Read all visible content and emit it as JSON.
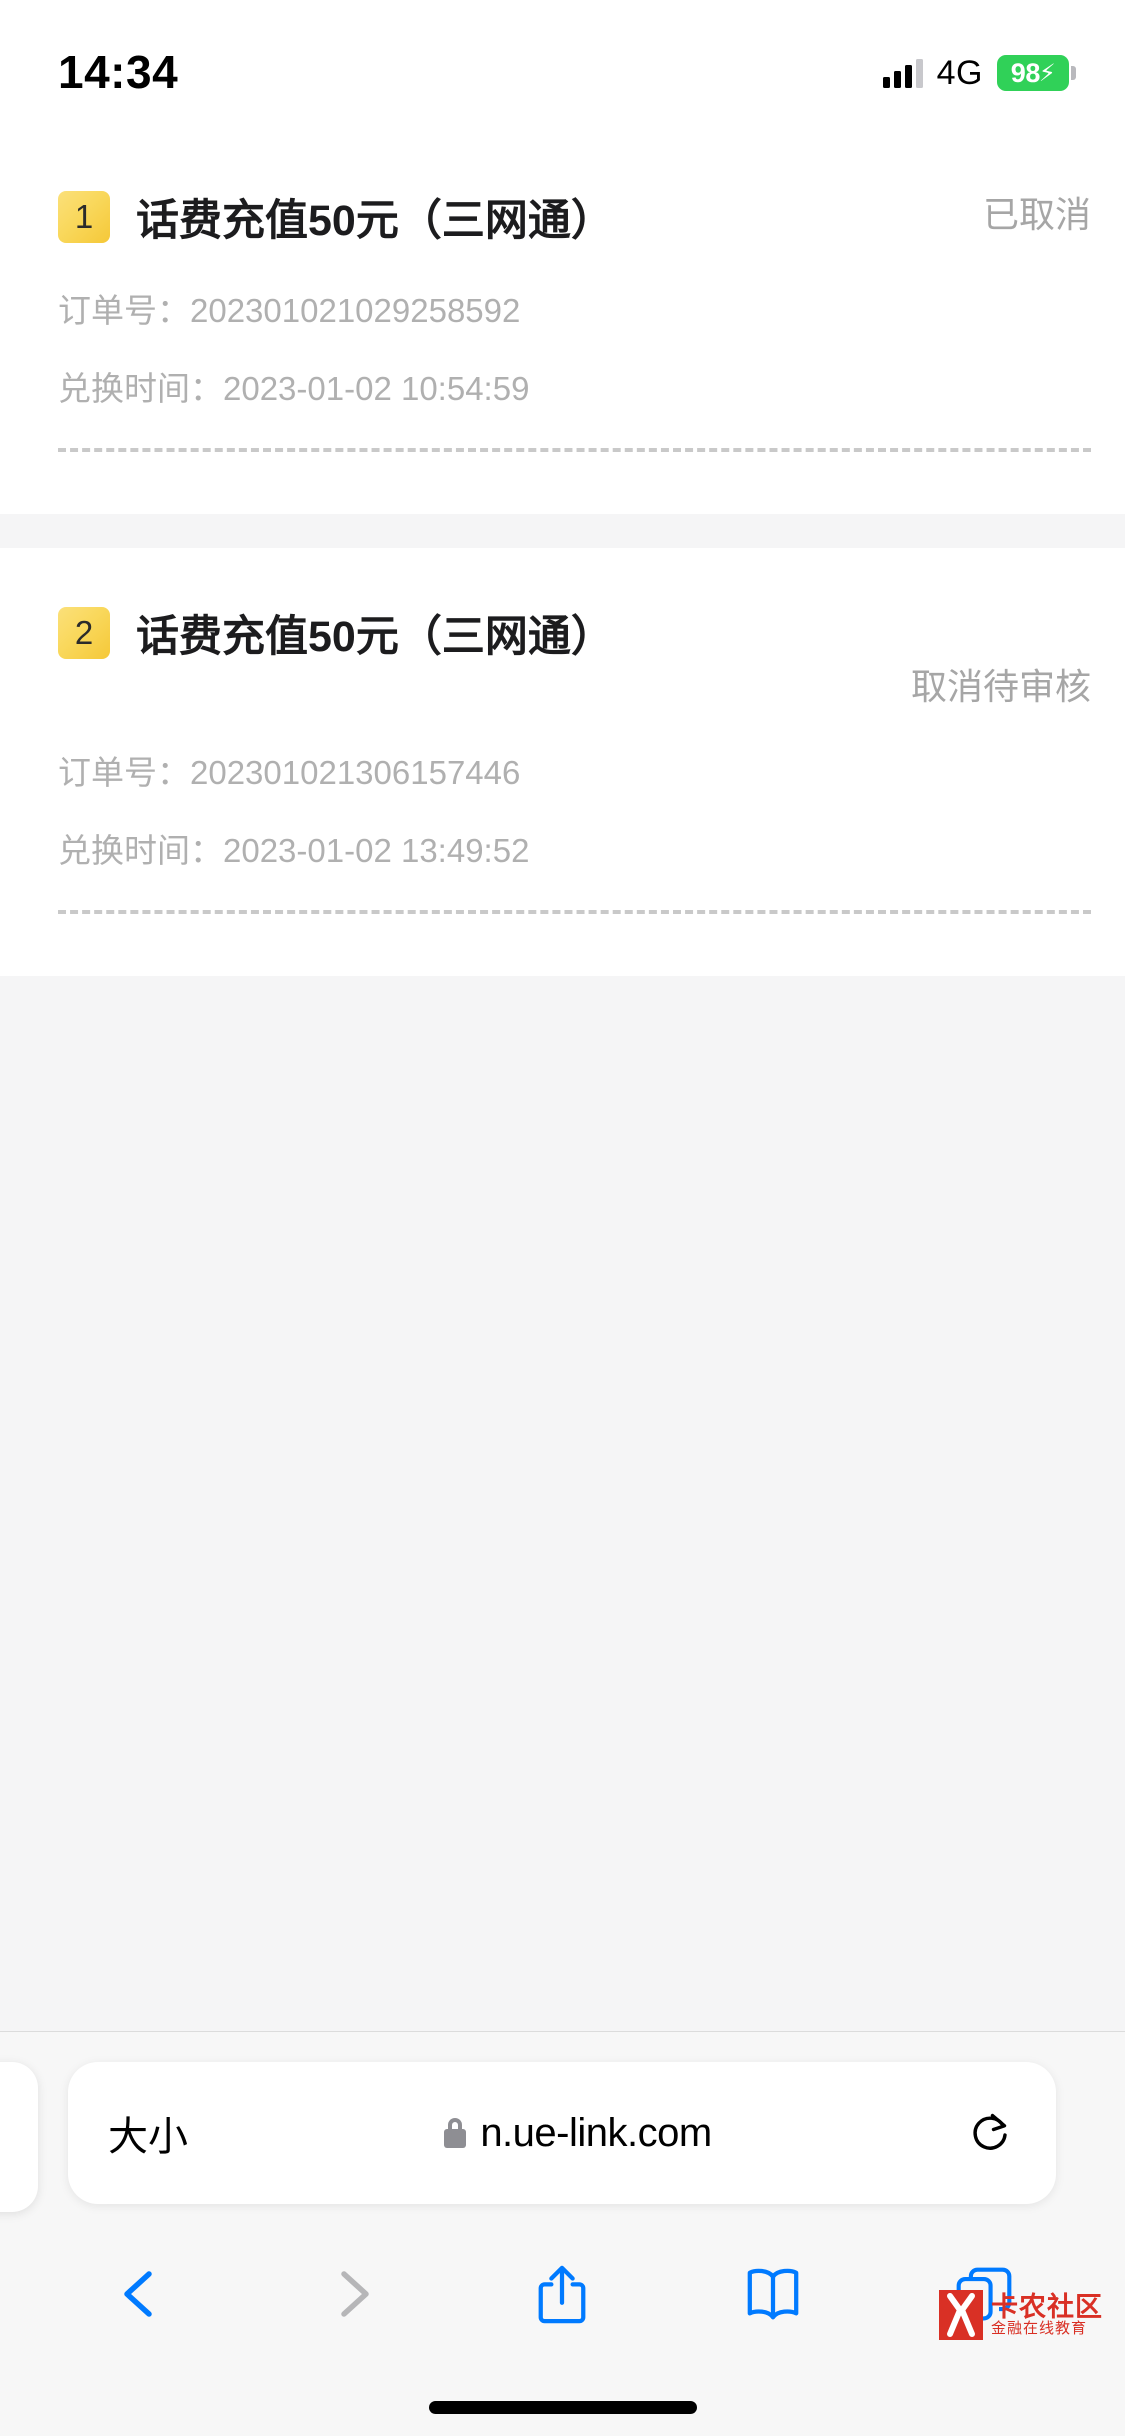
{
  "status_bar": {
    "time": "14:34",
    "network_type": "4G",
    "battery_level": "98",
    "battery_charging_glyph": "⚡",
    "signal_icon": "signal-bars-icon",
    "battery_icon": "battery-icon"
  },
  "page": {
    "background_color": "#f5f5f6",
    "card_background": "#ffffff",
    "badge_color": "#f5c838",
    "muted_text_color": "#b0b0b0",
    "status_text_color": "#a6a6a6",
    "orders": [
      {
        "index": "1",
        "title": "话费充值50元（三网通）",
        "status": "已取消",
        "order_no_label": "订单号：",
        "order_no": "202301021029258592",
        "time_label": "兑换时间：",
        "time": "2023-01-02 10:54:59"
      },
      {
        "index": "2",
        "title": "话费充值50元（三网通）",
        "status": "取消待审核",
        "order_no_label": "订单号：",
        "order_no": "202301021306157446",
        "time_label": "兑换时间：",
        "time": "2023-01-02 13:49:52"
      }
    ]
  },
  "browser": {
    "text_size_label": "大小",
    "url": "n.ue-link.com",
    "lock_icon": "lock-icon",
    "reload_icon": "reload-icon",
    "toolbar": {
      "back_icon": "chevron-left-icon",
      "forward_icon": "chevron-right-icon",
      "share_icon": "share-icon",
      "bookmarks_icon": "book-icon",
      "tabs_icon": "tabs-icon"
    },
    "accent_color": "#007aff",
    "disabled_color": "#b6b6b8"
  },
  "watermark": {
    "title": "卡农社区",
    "subtitle": "金融在线教育",
    "color": "#d93025"
  }
}
